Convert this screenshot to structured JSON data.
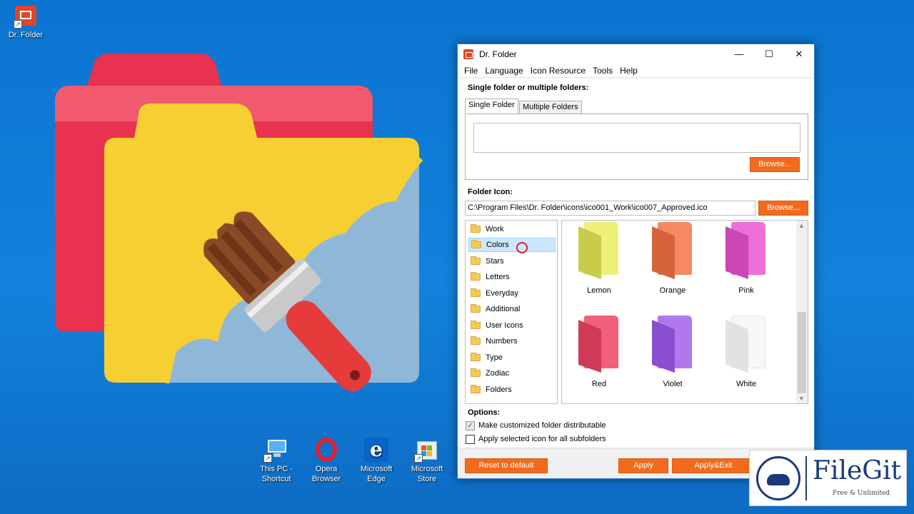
{
  "desktop": {
    "top_icon": {
      "label": "Dr. Folder"
    },
    "taskbar_icons": [
      {
        "label": "This PC - Shortcut",
        "icon": "this-pc-icon"
      },
      {
        "label": "Opera Browser",
        "icon": "opera-icon"
      },
      {
        "label": "Microsoft Edge",
        "icon": "edge-icon"
      },
      {
        "label": "Microsoft Store",
        "icon": "store-icon"
      }
    ]
  },
  "window": {
    "title": "Dr. Folder",
    "controls": {
      "minimize": "—",
      "maximize": "☐",
      "close": "✕"
    },
    "menu": [
      "File",
      "Language",
      "Icon Resource",
      "Tools",
      "Help"
    ],
    "single_or_multiple_label": "Single folder or multiple folders:",
    "tabs": [
      "Single Folder",
      "Multiple Folders"
    ],
    "folder_path_value": "",
    "browse_label": "Browse...",
    "folder_icon_label": "Folder Icon:",
    "icon_path_value": "C:\\Program Files\\Dr. Folder\\icons\\ico001_Work\\ico007_Approved.ico",
    "categories": [
      "Work",
      "Colors",
      "Stars",
      "Letters",
      "Everyday",
      "Additional",
      "User Icons",
      "Numbers",
      "Type",
      "Zodiac",
      "Folders"
    ],
    "selected_category": "Colors",
    "icons": [
      {
        "label": "Lemon",
        "color": "#eef07a",
        "dark": "#c9cb4a"
      },
      {
        "label": "Orange",
        "color": "#f48a64",
        "dark": "#d5643d"
      },
      {
        "label": "Pink",
        "color": "#ee6fd8",
        "dark": "#cc46b5"
      },
      {
        "label": "Red",
        "color": "#f0607a",
        "dark": "#cf3b57"
      },
      {
        "label": "Violet",
        "color": "#b178ee",
        "dark": "#8a4fd0"
      },
      {
        "label": "White",
        "color": "#f7f7f7",
        "dark": "#dcdcdc"
      }
    ],
    "options_label": "Options:",
    "options": [
      {
        "label": "Make customized folder distributable",
        "checked": true
      },
      {
        "label": "Apply selected icon for all subfolders",
        "checked": false
      }
    ],
    "buttons": {
      "reset": "Reset to default",
      "apply": "Apply",
      "apply_exit": "Apply&Exit"
    }
  },
  "watermark": {
    "brand": "FileGit",
    "tagline": "Free & Unlimited"
  },
  "colors": {
    "accent": "#f26b1d",
    "desktop": "#0b74d0",
    "selection": "#cce8ff"
  }
}
